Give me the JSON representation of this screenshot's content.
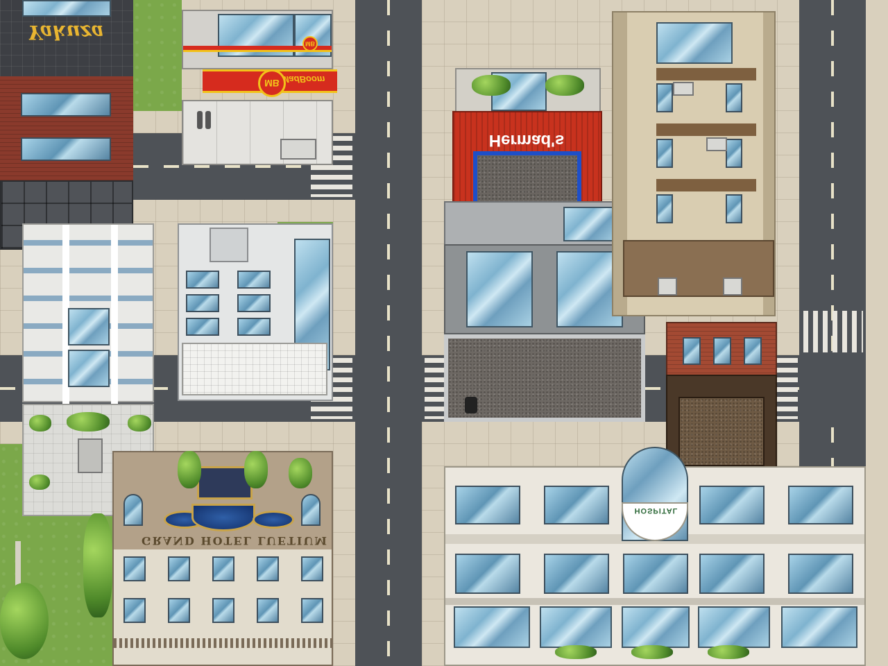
{
  "scene": {
    "type": "top-down city tilemap",
    "colors": {
      "road": "#4e5257",
      "sidewalk": "#d9d0bd",
      "grass": "#7ba84a",
      "lane_marking": "#e8e2c8",
      "hermads_red": "#c8321e",
      "hermads_blue": "#1e4fc8",
      "madboom_red": "#d62b1e",
      "madboom_yellow": "#f2c21a"
    }
  },
  "signs": {
    "yakuza": "Yakuza",
    "madboom_name": "MadBoom",
    "madboom_logo": "MB",
    "hermads": "Hermad's",
    "grand_hotel": "GRAND HOTEL LUETIUM",
    "hospital": "HOSPITAL"
  },
  "buildings": [
    {
      "id": "yakuza",
      "label_key": "signs.yakuza"
    },
    {
      "id": "madboom",
      "label_key": "signs.madboom_name"
    },
    {
      "id": "hermads",
      "label_key": "signs.hermads"
    },
    {
      "id": "grand-hotel",
      "label_key": "signs.grand_hotel"
    },
    {
      "id": "hospital",
      "label_key": "signs.hospital"
    }
  ],
  "icons": [
    "tree-icon",
    "bush-icon",
    "ac-unit-icon",
    "vent-pipe-icon",
    "door-icon"
  ]
}
